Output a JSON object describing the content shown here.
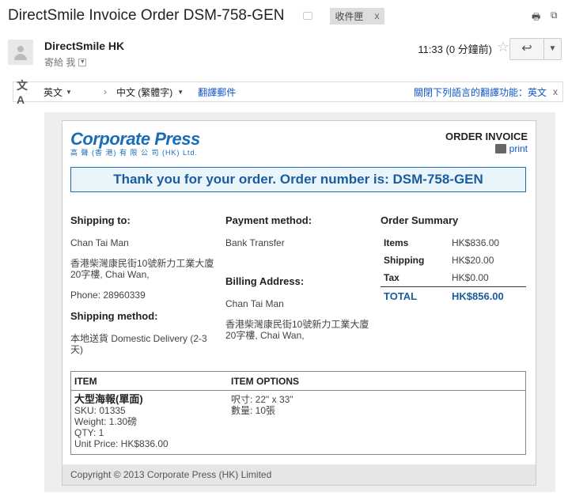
{
  "subject": "DirectSmile Invoice Order DSM-758-GEN",
  "inbox_tag": "收件匣",
  "inbox_tag_close": "x",
  "sender": {
    "name": "DirectSmile HK",
    "to_line": "寄給 我",
    "time": "11:33 (0 分鐘前)"
  },
  "translate": {
    "from_lang": "英文",
    "to_lang": "中文 (繁體字)",
    "translate_link": "翻譯郵件",
    "disable_link": "關閉下列語言的翻譯功能：英文",
    "close": "x"
  },
  "invoice": {
    "logo_main": "Corporate Press",
    "logo_sub": "高 聲 (香 港) 有 限 公 司   (HK) Ltd.",
    "order_invoice": "ORDER INVOICE",
    "print": "print",
    "thanks": "Thank you for your order. Order number is: DSM-758-GEN",
    "shipping_to_label": "Shipping to:",
    "shipping_name": "Chan Tai Man",
    "shipping_address": "香港柴灣康民街10號新力工業大廈20字樓, Chai Wan,",
    "phone": "Phone: 28960339",
    "shipping_method_label": "Shipping method:",
    "shipping_method": "本地送貨 Domestic Delivery (2-3 天)",
    "payment_label": "Payment method:",
    "payment": "Bank Transfer",
    "billing_label": "Billing Address:",
    "billing_name": "Chan Tai Man",
    "billing_address": "香港柴灣康民街10號新力工業大廈20字樓, Chai Wan,",
    "summary_label": "Order Summary",
    "summary": [
      {
        "k": "Items",
        "v": "HK$836.00"
      },
      {
        "k": "Shipping",
        "v": "HK$20.00"
      },
      {
        "k": "Tax",
        "v": "HK$0.00"
      }
    ],
    "total_label": "TOTAL",
    "total_value": "HK$856.00",
    "items_head_item": "ITEM",
    "items_head_options": "ITEM OPTIONS",
    "item_title": "大型海報(單面)",
    "item_sku": "SKU: 01335",
    "item_weight": "Weight: 1.30磅",
    "item_qty": "QTY: 1",
    "item_price": "Unit Price: HK$836.00",
    "option_size": "呎寸: 22\" x 33\"",
    "option_qty": "數量: 10張",
    "footer": "Copyright © 2013 Corporate Press (HK) Limited"
  }
}
